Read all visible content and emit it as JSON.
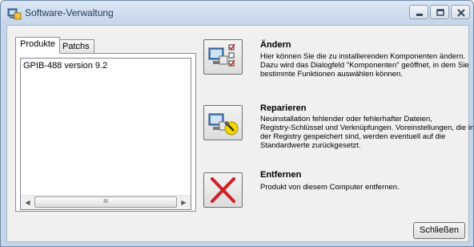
{
  "window": {
    "title": "Software-Verwaltung",
    "controls": {
      "minimize": "minimize-icon",
      "maximize": "maximize-icon",
      "close": "close-icon"
    }
  },
  "tabs": [
    {
      "label": "Produkte",
      "active": true
    },
    {
      "label": "Patchs",
      "active": false
    }
  ],
  "products": {
    "items": [
      "GPIB-488 version 9.2"
    ],
    "scrollbar": {
      "left_arrow": "◀",
      "right_arrow": "▶",
      "grip": "III"
    }
  },
  "actions": [
    {
      "title": "Ändern",
      "description": "Hier können Sie die zu installierenden Komponenten ändern.\nDazu wird das Dialogfeld \"Komponenten\" geöffnet, in dem Sie\nbestimmte Funktionen auswählen können.",
      "icon": "modify-components-icon"
    },
    {
      "title": "Reparieren",
      "description": "Neuinstallation fehlender oder fehlerhafter Dateien,\nRegistry-Schlüssel und Verknüpfungen. Voreinstellungen, die in\nder Registry gespeichert sind, werden eventuell auf die\nStandardwerte zurückgesetzt.",
      "icon": "repair-icon"
    },
    {
      "title": "Entfernen",
      "description": "Produkt von diesem Computer entfernen.",
      "icon": "remove-x-icon"
    }
  ],
  "footer": {
    "close_label": "Schließen"
  },
  "colors": {
    "remove_x": "#d21f26",
    "titlebar": "#c5d6ea",
    "dialog_bg": "#f0f0f0"
  }
}
